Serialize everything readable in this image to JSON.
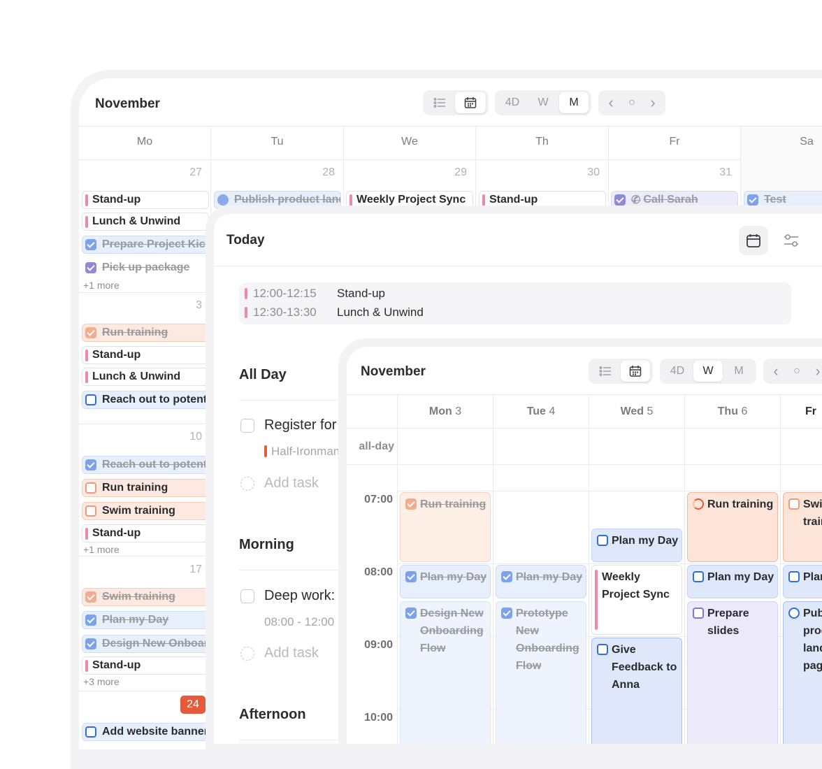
{
  "month_window": {
    "title": "November",
    "view_toggle": {
      "list_icon": "list-icon",
      "calendar_icon": "calendar-icon"
    },
    "range_buttons": [
      "4D",
      "W",
      "M"
    ],
    "active_range": "M",
    "nav": {
      "prev": "‹",
      "today": "○",
      "next": "›"
    },
    "weekdays": [
      "Mo",
      "Tu",
      "We",
      "Th",
      "Fr",
      "Sa"
    ],
    "dates_row1": [
      "27",
      "28",
      "29",
      "30",
      "31",
      ""
    ],
    "row1_events": {
      "tu": "Publish product landing page",
      "we": "Weekly Project Sync",
      "th": "Stand-up",
      "fr": "Call Sarah",
      "sa": "Test"
    },
    "monday": {
      "week1": {
        "events": [
          "Stand-up",
          "Lunch & Unwind",
          "Prepare Project Kickoff",
          "Pick up package"
        ],
        "more": "+1 more"
      },
      "week2": {
        "date": "3",
        "events": [
          "Run training",
          "Stand-up",
          "Lunch & Unwind",
          "Reach out to potential"
        ]
      },
      "week3": {
        "date": "10",
        "events": [
          "Reach out to potential",
          "Run training",
          "Swim training",
          "Stand-up"
        ],
        "more": "+1 more"
      },
      "week4": {
        "date": "17",
        "events": [
          "Swim training",
          "Plan my Day",
          "Design New Onboarding",
          "Stand-up"
        ],
        "more": "+3 more"
      },
      "week5": {
        "date": "24",
        "events": [
          "Add website banner"
        ]
      }
    }
  },
  "today_window": {
    "title": "Today",
    "schedule": [
      {
        "time": "12:00-12:15",
        "title": "Stand-up"
      },
      {
        "time": "12:30-13:30",
        "title": "Lunch & Unwind"
      }
    ],
    "sections": {
      "all_day": "All Day",
      "morning": "Morning",
      "afternoon": "Afternoon"
    },
    "tasks": {
      "register": "Register for",
      "register_sub": "Half-Ironman",
      "deep_work": "Deep work:",
      "deep_work_sub": "08:00 - 12:00",
      "add_task": "Add task"
    }
  },
  "week_window": {
    "title": "November",
    "range_buttons": [
      "4D",
      "W",
      "M"
    ],
    "active_range": "W",
    "nav": {
      "prev": "‹",
      "today": "○",
      "next": "›"
    },
    "days": [
      {
        "name": "Mon",
        "num": "3"
      },
      {
        "name": "Tue",
        "num": "4"
      },
      {
        "name": "Wed",
        "num": "5"
      },
      {
        "name": "Thu",
        "num": "6"
      },
      {
        "name": "Fr",
        "num": ""
      }
    ],
    "all_day_label": "all-day",
    "times": [
      "07:00",
      "08:00",
      "09:00",
      "10:00"
    ],
    "events": {
      "mon_run": "Run training",
      "mon_plan": "Plan my Day",
      "mon_design": "Design New Onboarding Flow",
      "tue_plan": "Plan my Day",
      "tue_proto": "Prototype New Onboarding Flow",
      "wed_plan": "Plan my Day",
      "wed_sync": "Weekly Project Sync",
      "wed_feedback": "Give Feedback to Anna",
      "thu_run": "Run training",
      "thu_plan": "Plan my Day",
      "thu_slides": "Prepare slides",
      "fri_swim": "Swim training",
      "fri_plan": "Plan my Day",
      "fri_publish": "Publish product landing page"
    }
  },
  "colors": {
    "accent_blue": "#2f6de1",
    "today_red": "#e45a3b",
    "pink_bar": "#ee8aa9"
  }
}
